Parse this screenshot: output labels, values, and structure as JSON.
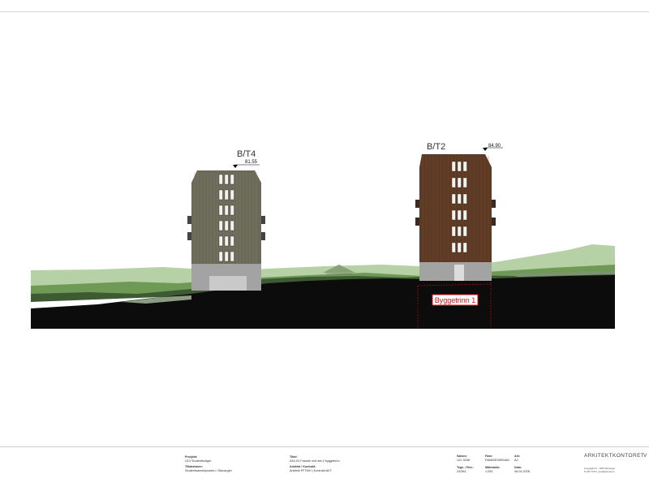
{
  "drawing": {
    "buildings": [
      {
        "name": "B/T4",
        "height_mark": "81.55"
      },
      {
        "name": "B/T2",
        "height_mark": "84.90"
      }
    ],
    "phase_label": "Byggetrinn 1",
    "colors": {
      "ground": "#0c0c0c",
      "vegetation": "#6f9a55",
      "hill": "#a9c79a",
      "bt4_cladding": "#6b6957",
      "bt2_cladding": "#5d3a23",
      "base": "#a3a3a3",
      "phase_box": "#d11a1a"
    }
  },
  "title_block": {
    "project": {
      "label": "Prosjekt:",
      "value": "U13 Studentboliger"
    },
    "client": {
      "label": "Tiltakshaver:",
      "value": "Studentsamskipnaden i Stavanger"
    },
    "title": {
      "label": "Tittel:",
      "value": "A40-03 Fasade mot øst 2 byggetrinn"
    },
    "architect": {
      "label": "Arkitekt / Kontrakt:",
      "value": "Arkitekt FFTMH | Kontrakt AKT"
    },
    "job_no": {
      "label": "Saksnr:",
      "value": "122-3038"
    },
    "phase": {
      "label": "Fase:",
      "value": "RAMMESØKNAD"
    },
    "size": {
      "label": "Ark:",
      "value": "A2"
    },
    "drawing_no": {
      "label": "Tegn. / Rev.:",
      "value": "24/381"
    },
    "scale": {
      "label": "Målestokk:",
      "value": "1:250"
    },
    "date": {
      "label": "Dato:",
      "value": "06.04.2026"
    },
    "firm": "ARKITEKTKONTORET",
    "firm_trail": "V",
    "firm_address": "Kongsgård 9 · 4005 Stavanger",
    "firm_contact": "51 89 73 83 | post@arkmat.no"
  }
}
